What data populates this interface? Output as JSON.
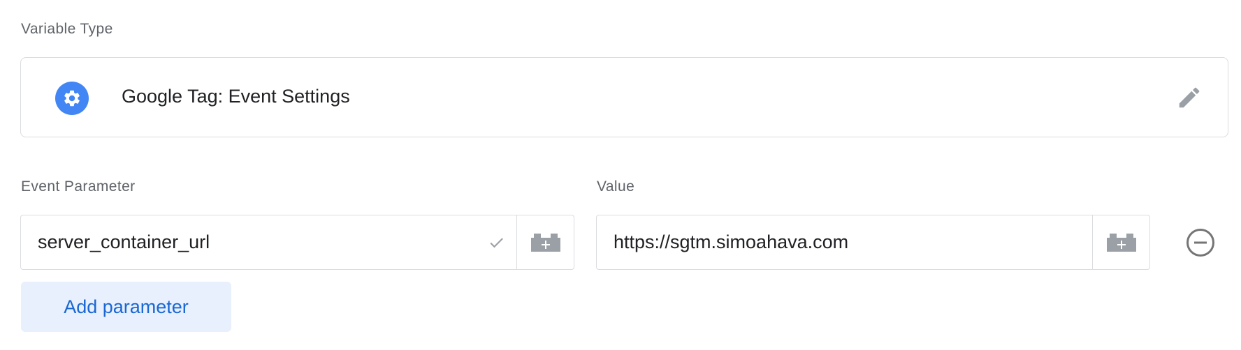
{
  "variable_type": {
    "section_label": "Variable Type",
    "name": "Google Tag: Event Settings",
    "icon": "gear-icon",
    "edit_icon": "pencil-icon"
  },
  "parameters": {
    "param_label": "Event Parameter",
    "value_label": "Value",
    "rows": [
      {
        "parameter": "server_container_url",
        "value": "https://sgtm.simoahava.com",
        "valid_icon": "check-icon",
        "variable_picker_icon": "lego-brick-plus-icon",
        "remove_icon": "minus-circle-icon"
      }
    ],
    "add_button_label": "Add parameter"
  },
  "colors": {
    "accent": "#4285f4",
    "button_bg": "#e8f0fe",
    "button_text": "#1967d2",
    "border": "#dadce0",
    "label_text": "#5f6368",
    "icon_gray": "#9aa0a6"
  }
}
